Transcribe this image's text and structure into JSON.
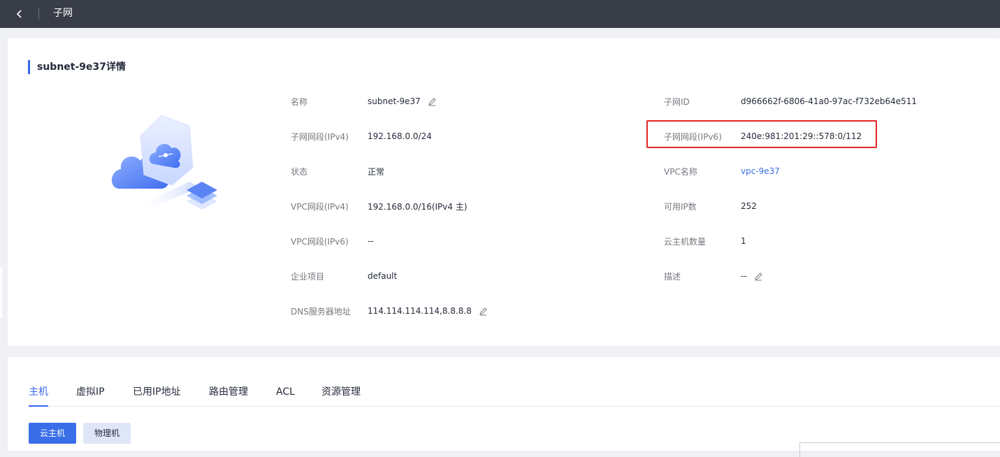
{
  "topbar": {
    "title": "子网"
  },
  "detail": {
    "section_title": "subnet-9e37详情",
    "left": [
      {
        "label": "名称",
        "value": "subnet-9e37",
        "editable": true
      },
      {
        "label": "子网网段(IPv4)",
        "value": "192.168.0.0/24"
      },
      {
        "label": "状态",
        "value": "正常"
      },
      {
        "label": "VPC网段(IPv4)",
        "value": "192.168.0.0/16(IPv4 主)"
      },
      {
        "label": "VPC网段(IPv6)",
        "value": "--"
      },
      {
        "label": "企业项目",
        "value": "default"
      },
      {
        "label": "DNS服务器地址",
        "value": "114.114.114.114,8.8.8.8",
        "editable": true
      }
    ],
    "right": [
      {
        "label": "子网ID",
        "value": "d966662f-6806-41a0-97ac-f732eb64e511"
      },
      {
        "label": "子网网段(IPv6)",
        "value": "240e:981:201:29::578:0/112"
      },
      {
        "label": "VPC名称",
        "value": "vpc-9e37",
        "link": true
      },
      {
        "label": "可用IP数",
        "value": "252"
      },
      {
        "label": "云主机数量",
        "value": "1"
      },
      {
        "label": "描述",
        "value": "--",
        "editable": true
      }
    ]
  },
  "tabs": [
    "主机",
    "虚拟IP",
    "已用IP地址",
    "路由管理",
    "ACL",
    "资源管理"
  ],
  "active_tab": "主机",
  "buttons": {
    "primary": "云主机",
    "secondary": "物理机"
  },
  "colors": {
    "accent": "#3867f0",
    "highlight": "#e02424",
    "topbar": "#393d48"
  }
}
